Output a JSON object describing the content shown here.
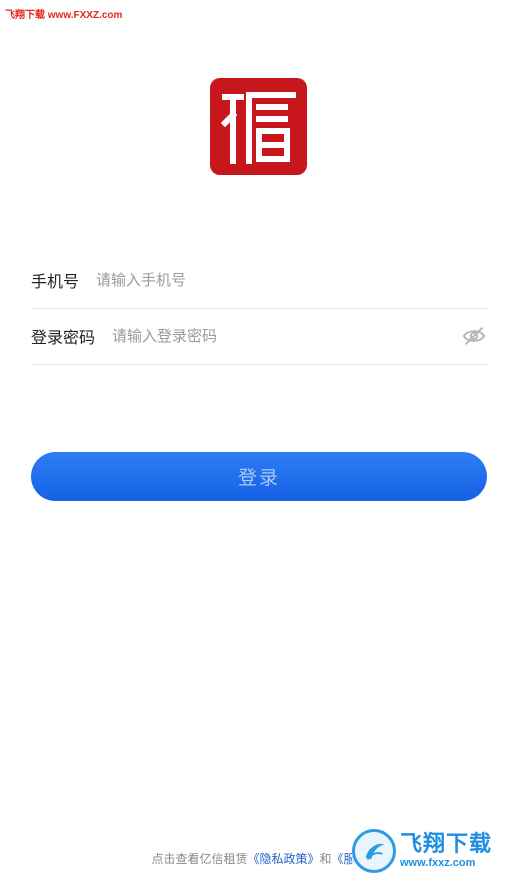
{
  "watermark_top": "飞翔下载 www.FXXZ.com",
  "logo": {
    "icon": "seal-logo-icon",
    "color": "#c8161d"
  },
  "phone_field": {
    "label": "手机号",
    "placeholder": "请输入手机号"
  },
  "password_field": {
    "label": "登录密码",
    "placeholder": "请输入登录密码",
    "toggle_icon": "eye-off-icon"
  },
  "login_button": {
    "label": "登录",
    "color": "#1f6ff0"
  },
  "agreement": {
    "prefix": "点击查看亿信租赁",
    "privacy_link": "《隐私政策》",
    "conjunction": "和",
    "service_link": "《服务"
  },
  "watermark_bottom": {
    "title": "飞翔下载",
    "url": "www.fxxz.com"
  }
}
